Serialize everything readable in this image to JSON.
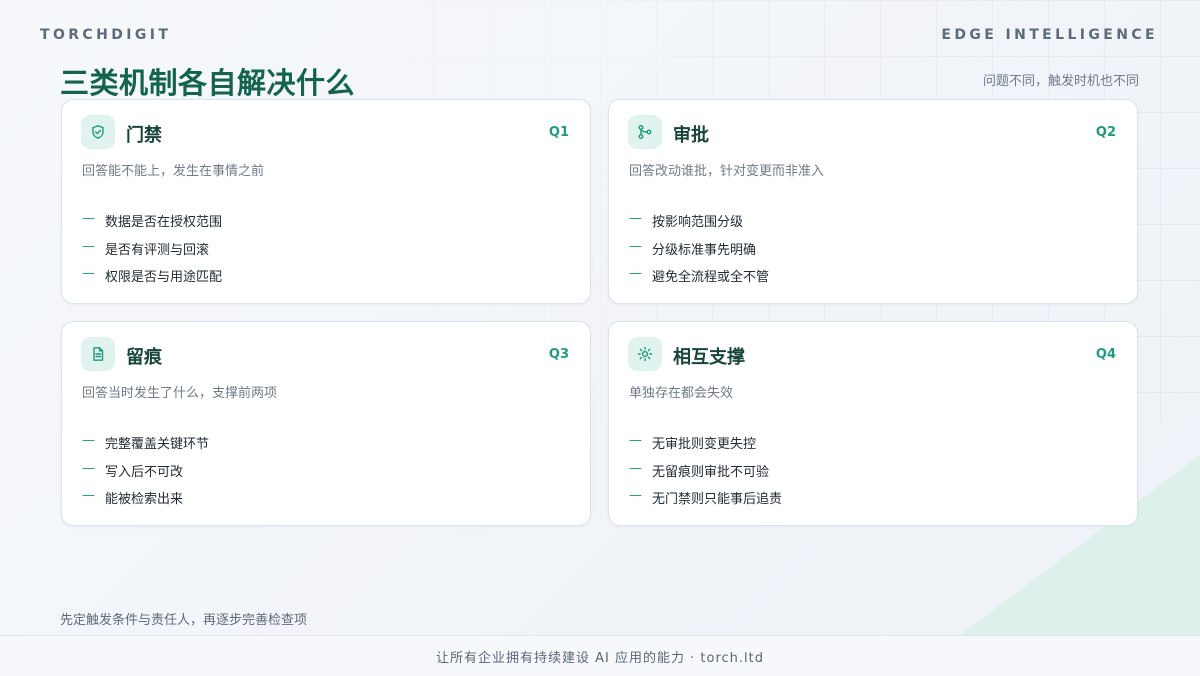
{
  "header": {
    "brand": "TORCHDIGIT",
    "edge_label": "EDGE INTELLIGENCE",
    "title": "三类机制各自解决什么",
    "subtitle": "问题不同，触发时机也不同"
  },
  "colors": {
    "accent": "#1f9a7e",
    "title": "#13634f",
    "icon_bg": "#e0f3ee"
  },
  "cards": [
    {
      "icon": "shield-check-icon",
      "title": "门禁",
      "tag": "Q1",
      "desc": "回答能不能上，发生在事情之前",
      "items": [
        "数据是否在授权范围",
        "是否有评测与回滚",
        "权限是否与用途匹配"
      ]
    },
    {
      "icon": "workflow-branch-icon",
      "title": "审批",
      "tag": "Q2",
      "desc": "回答改动谁批，针对变更而非准入",
      "items": [
        "按影响范围分级",
        "分级标准事先明确",
        "避免全流程或全不管"
      ]
    },
    {
      "icon": "document-icon",
      "title": "留痕",
      "tag": "Q3",
      "desc": "回答当时发生了什么，支撑前两项",
      "items": [
        "完整覆盖关键环节",
        "写入后不可改",
        "能被检索出来"
      ]
    },
    {
      "icon": "sun-icon",
      "title": "相互支撑",
      "tag": "Q4",
      "desc": "单独存在都会失效",
      "items": [
        "无审批则变更失控",
        "无留痕则审批不可验",
        "无门禁则只能事后追责"
      ]
    }
  ],
  "bottom_note": "先定触发条件与责任人，再逐步完善检查项",
  "footer": {
    "text": "让所有企业拥有持续建设 AI 应用的能力 · torch.ltd"
  }
}
